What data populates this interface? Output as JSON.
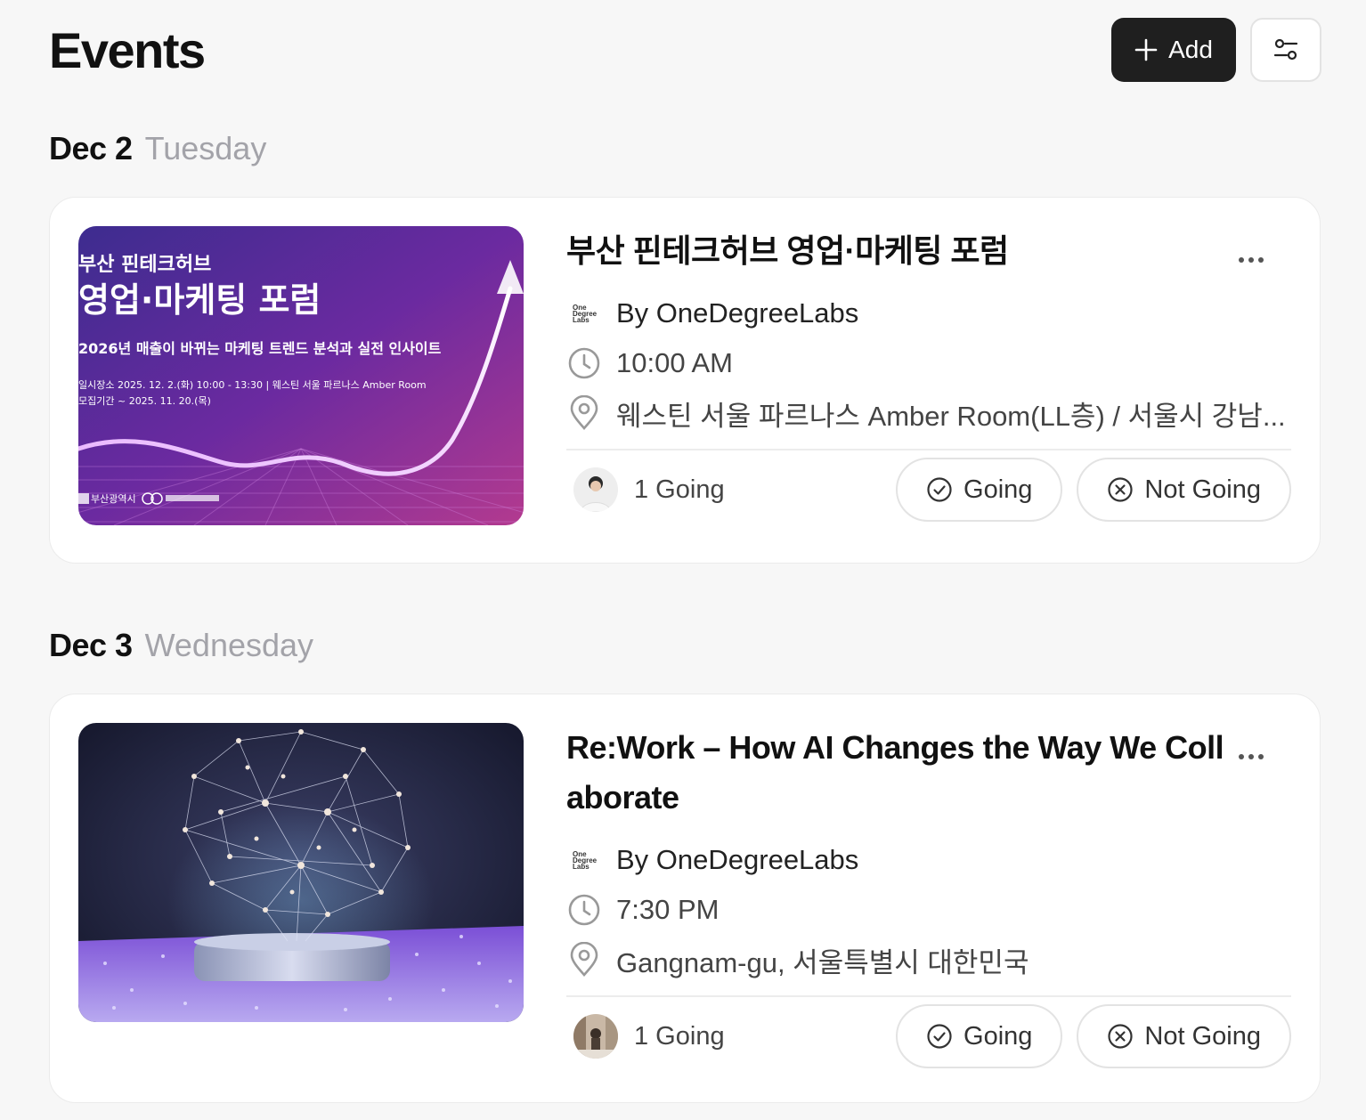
{
  "header": {
    "title": "Events",
    "add_label": "Add"
  },
  "days": [
    {
      "date": "Dec 2",
      "weekday": "Tuesday"
    },
    {
      "date": "Dec 3",
      "weekday": "Wednesday"
    }
  ],
  "events": [
    {
      "title": "부산 핀테크허브 영업·마케팅 포럼",
      "host": "By OneDegreeLabs",
      "time": "10:00 AM",
      "location": "웨스틴 서울 파르나스 Amber Room(LL층) / 서울시 강남...",
      "going_count": "1 Going",
      "going_label": "Going",
      "not_going_label": "Not Going",
      "poster": {
        "line1": "부산 핀테크허브",
        "line2": "영업·마케팅 포럼",
        "line3": "2026년 매출이 바뀌는 마케팅 트렌드 분석과 실전 인사이트",
        "line4": "일시장소  2025. 12. 2.(화) 10:00 - 13:30  |  웨스틴 서울 파르나스 Amber Room",
        "line5": "모집기간  ~ 2025. 11. 20.(목)",
        "org": "부산광역시"
      }
    },
    {
      "title": "Re:Work – How AI Changes the Way We Coll aborate",
      "host": "By OneDegreeLabs",
      "time": "7:30 PM",
      "location": "Gangnam-gu, 서울특별시 대한민국",
      "going_count": "1 Going",
      "going_label": "Going",
      "not_going_label": "Not Going"
    }
  ],
  "host_logo_text": [
    "One",
    "Degree",
    "Labs"
  ],
  "icons": {
    "add": "plus-icon",
    "filter": "sliders-icon",
    "more": "ellipsis-icon",
    "time": "clock-icon",
    "location": "map-pin-icon",
    "going": "check-circle-icon",
    "not_going": "x-circle-icon"
  },
  "colors": {
    "accent_dark": "#1f1f1f",
    "background": "#f7f7f7",
    "muted": "#a3a3a9"
  }
}
